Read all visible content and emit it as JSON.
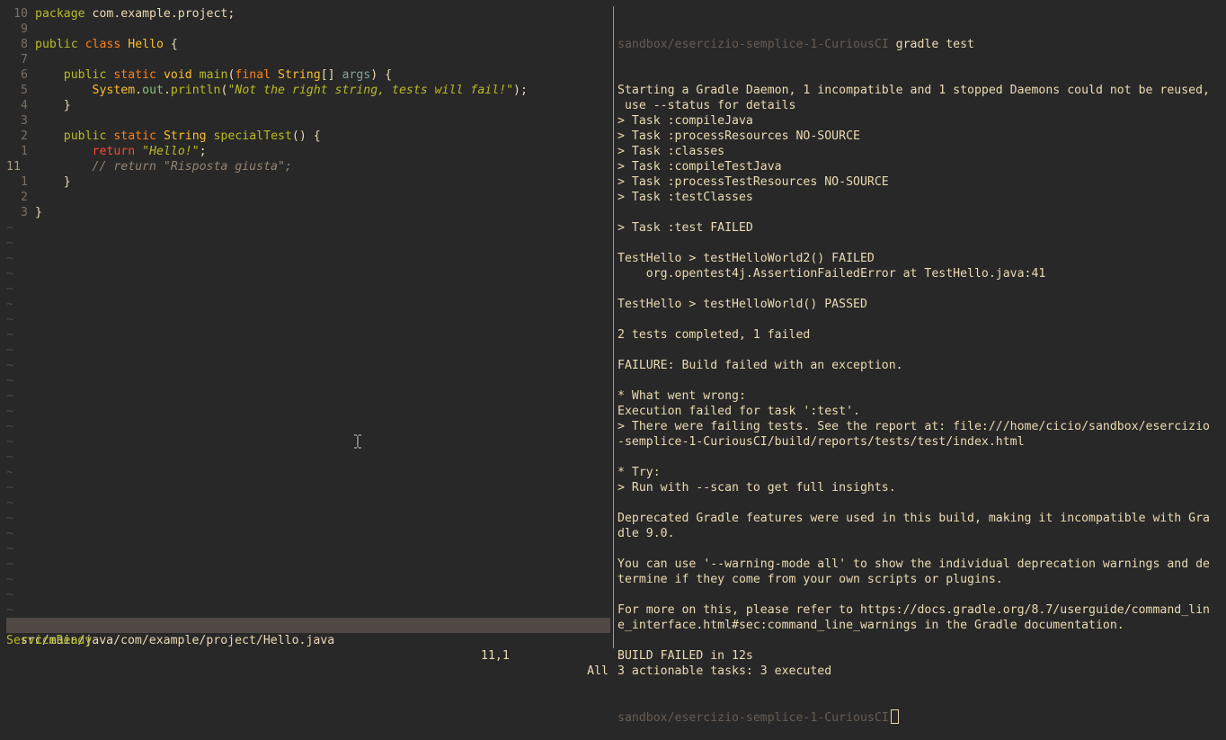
{
  "editor": {
    "lines": [
      {
        "num": "10",
        "parts": [
          [
            "kw-green",
            "package"
          ],
          [
            "fg",
            " com.example.project;"
          ]
        ]
      },
      {
        "num": "9",
        "parts": []
      },
      {
        "num": "8",
        "parts": [
          [
            "kw-green",
            "public"
          ],
          [
            "fg",
            " "
          ],
          [
            "kw-orange",
            "class"
          ],
          [
            "fg",
            " "
          ],
          [
            "cls",
            "Hello"
          ],
          [
            "fg",
            " {"
          ]
        ]
      },
      {
        "num": "7",
        "parts": []
      },
      {
        "num": "6",
        "parts": [
          [
            "fg",
            "    "
          ],
          [
            "kw-green",
            "public"
          ],
          [
            "fg",
            " "
          ],
          [
            "kw-orange",
            "static"
          ],
          [
            "fg",
            " "
          ],
          [
            "kw-yellow",
            "void"
          ],
          [
            "fg",
            " "
          ],
          [
            "fn",
            "main"
          ],
          [
            "fg",
            "("
          ],
          [
            "kw-orange",
            "final"
          ],
          [
            "fg",
            " "
          ],
          [
            "cls",
            "String"
          ],
          [
            "fg",
            "[] "
          ],
          [
            "blue",
            "args"
          ],
          [
            "fg",
            ") {"
          ]
        ]
      },
      {
        "num": "5",
        "parts": [
          [
            "fg",
            "        "
          ],
          [
            "cls",
            "System"
          ],
          [
            "fg",
            "."
          ],
          [
            "aqua",
            "out"
          ],
          [
            "fg",
            "."
          ],
          [
            "fn",
            "println"
          ],
          [
            "fg",
            "("
          ],
          [
            "str",
            "\"Not the right string, tests will fail!\""
          ],
          [
            "fg",
            ");"
          ]
        ]
      },
      {
        "num": "4",
        "parts": [
          [
            "fg",
            "    }"
          ]
        ]
      },
      {
        "num": "3",
        "parts": []
      },
      {
        "num": "2",
        "parts": [
          [
            "fg",
            "    "
          ],
          [
            "kw-green",
            "public"
          ],
          [
            "fg",
            " "
          ],
          [
            "kw-orange",
            "static"
          ],
          [
            "fg",
            " "
          ],
          [
            "cls",
            "String"
          ],
          [
            "fg",
            " "
          ],
          [
            "fn",
            "specialTest"
          ],
          [
            "fg",
            "() {"
          ]
        ]
      },
      {
        "num": "1",
        "parts": [
          [
            "fg",
            "        "
          ],
          [
            "kw-red",
            "return"
          ],
          [
            "fg",
            " "
          ],
          [
            "str",
            "\"Hello!\""
          ],
          [
            "fg",
            ";"
          ]
        ]
      },
      {
        "num": "11",
        "current": true,
        "parts": [
          [
            "cmt",
            "        // return \"Risposta giusta\";"
          ]
        ]
      },
      {
        "num": "1",
        "parts": [
          [
            "fg",
            "    }"
          ]
        ]
      },
      {
        "num": "2",
        "parts": []
      },
      {
        "num": "3",
        "parts": [
          [
            "fg",
            "}"
          ]
        ]
      }
    ],
    "tilde_count": 26,
    "tilde_char": "~"
  },
  "statusline": {
    "file": "src/main/java/com/example/project/Hello.java",
    "position": "11,1",
    "scroll": "All"
  },
  "cmdline": "ServiceReady",
  "terminal": {
    "prompt_dir": "sandbox/esercizio-semplice-1-CuriousCI",
    "command": "gradle test",
    "output": [
      "Starting a Gradle Daemon, 1 incompatible and 1 stopped Daemons could not be reused,",
      " use --status for details",
      "> Task :compileJava",
      "> Task :processResources NO-SOURCE",
      "> Task :classes",
      "> Task :compileTestJava",
      "> Task :processTestResources NO-SOURCE",
      "> Task :testClasses",
      "",
      "> Task :test FAILED",
      "",
      "TestHello > testHelloWorld2() FAILED",
      "    org.opentest4j.AssertionFailedError at TestHello.java:41",
      "",
      "TestHello > testHelloWorld() PASSED",
      "",
      "2 tests completed, 1 failed",
      "",
      "FAILURE: Build failed with an exception.",
      "",
      "* What went wrong:",
      "Execution failed for task ':test'.",
      "> There were failing tests. See the report at: file:///home/cicio/sandbox/esercizio",
      "-semplice-1-CuriousCI/build/reports/tests/test/index.html",
      "",
      "* Try:",
      "> Run with --scan to get full insights.",
      "",
      "Deprecated Gradle features were used in this build, making it incompatible with Gra",
      "dle 9.0.",
      "",
      "You can use '--warning-mode all' to show the individual deprecation warnings and de",
      "termine if they come from your own scripts or plugins.",
      "",
      "For more on this, please refer to https://docs.gradle.org/8.7/userguide/command_lin",
      "e_interface.html#sec:command_line_warnings in the Gradle documentation.",
      "",
      "BUILD FAILED in 12s",
      "3 actionable tasks: 3 executed"
    ],
    "final_prompt_dir": "sandbox/esercizio-semplice-1-CuriousCI"
  },
  "colors": {
    "background": "#282828",
    "foreground": "#ebdbb2",
    "statusline_bg": "#504945",
    "keyword_green": "#b8bb26",
    "keyword_orange": "#fe8019",
    "keyword_red": "#fb4934",
    "type_yellow": "#fabd2f",
    "comment": "#928374"
  },
  "icons": {
    "mouse_cursor": "text-ibeam-cursor-icon"
  }
}
